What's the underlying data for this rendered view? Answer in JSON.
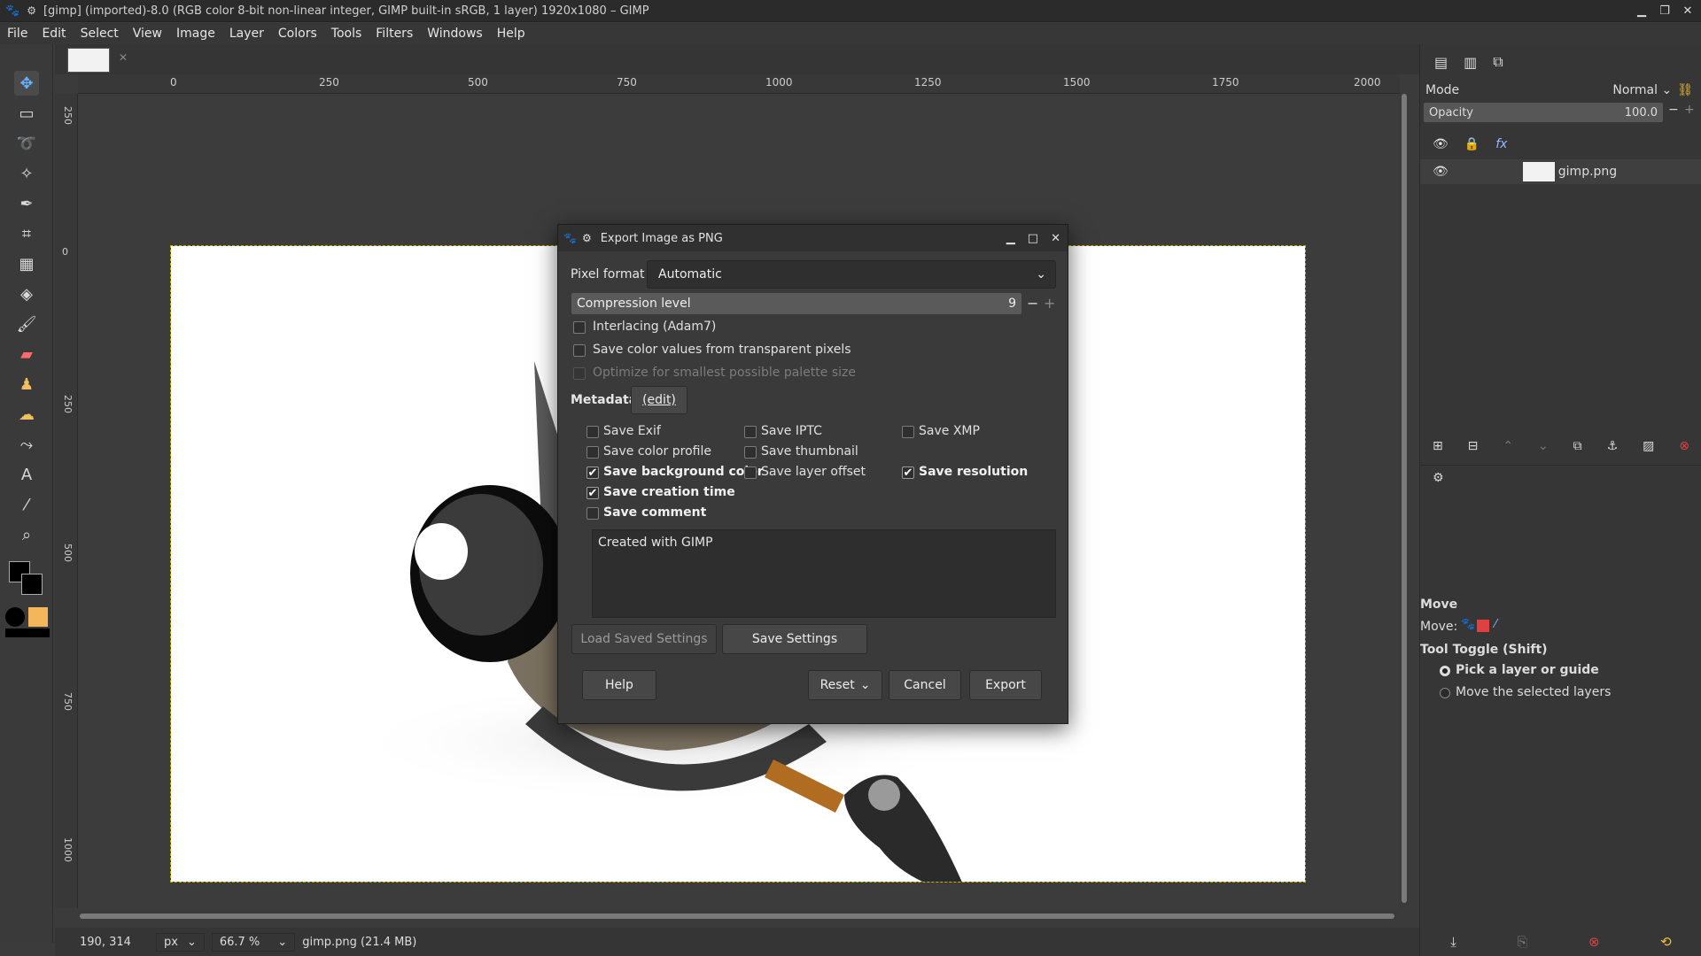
{
  "window": {
    "title": "[gimp] (imported)-8.0 (RGB color 8-bit non-linear integer, GIMP built-in sRGB, 1 layer) 1920x1080 – GIMP"
  },
  "menu": [
    "File",
    "Edit",
    "Select",
    "View",
    "Image",
    "Layer",
    "Colors",
    "Tools",
    "Filters",
    "Windows",
    "Help"
  ],
  "ruler": {
    "top": [
      "0",
      "250",
      "500",
      "750",
      "1000",
      "1250",
      "1500",
      "1750",
      "2000"
    ],
    "left": [
      "250",
      "0",
      "250",
      "500",
      "750",
      "1000"
    ]
  },
  "status": {
    "coords": "190, 314",
    "unit": "px",
    "zoom": "66.7 %",
    "file": "gimp.png (21.4 MB)"
  },
  "layers_panel": {
    "mode_label": "Mode",
    "mode_value": "Normal",
    "opacity_label": "Opacity",
    "opacity_value": "100.0",
    "layer_name": "gimp.png"
  },
  "tool_options": {
    "title": "Move",
    "move_label": "Move:",
    "toggle_label": "Tool Toggle  (Shift)",
    "option1": "Pick a layer or guide",
    "option2": "Move the selected layers"
  },
  "dialog": {
    "title": "Export Image as PNG",
    "pixel_format_label": "Pixel format",
    "pixel_format_value": "Automatic",
    "compression_label": "Compression level",
    "compression_value": "9",
    "interlacing": "Interlacing (Adam7)",
    "save_transparent": "Save color values from transparent pixels",
    "optimize_palette": "Optimize for smallest possible palette size",
    "metadata_label": "Metadata",
    "metadata_edit": "(edit)",
    "save_exif": "Save Exif",
    "save_iptc": "Save IPTC",
    "save_xmp": "Save XMP",
    "save_color_profile": "Save color profile",
    "save_thumbnail": "Save thumbnail",
    "save_bg_color": "Save background color",
    "save_layer_offset": "Save layer offset",
    "save_resolution": "Save resolution",
    "save_creation_time": "Save creation time",
    "save_comment": "Save comment",
    "comment_text": "Created with GIMP",
    "load_settings": "Load Saved Settings",
    "save_settings": "Save Settings",
    "help": "Help",
    "reset": "Reset",
    "cancel": "Cancel",
    "export": "Export"
  },
  "colors": {
    "accent": "#66b3ff",
    "bg": "#3b3b3b",
    "fg_swatch": "#000000",
    "brush_swatch": "#f4b65a",
    "close_red": "#e04040"
  },
  "icons": {
    "move_tool": "move-icon",
    "rect_select": "rect-select-icon",
    "lasso": "lasso-icon",
    "fuzzy": "fuzzy-select-icon",
    "path": "path-icon",
    "crop": "crop-icon",
    "transform": "transform-icon",
    "bucket": "bucket-fill-icon",
    "paintbrush": "paintbrush-icon",
    "eraser": "eraser-icon",
    "clone": "clone-icon",
    "smudge": "smudge-icon",
    "warp": "warp-icon",
    "text": "text-icon",
    "picker": "color-picker-icon",
    "zoom": "zoom-icon"
  }
}
